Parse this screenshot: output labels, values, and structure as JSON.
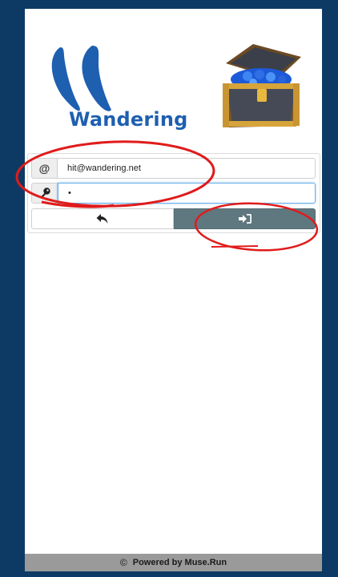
{
  "brand": {
    "name": "Wandering"
  },
  "login_form": {
    "email_addon": "@",
    "email_value": "hit@wandering.net",
    "password_value": "•",
    "back_icon": "reply-icon",
    "login_icon": "sign-in-icon"
  },
  "footer": {
    "copyright_symbol": "©",
    "text": "Powered by Muse.Run"
  },
  "colors": {
    "background": "#0d3a64",
    "brand_blue": "#1e5fb0",
    "login_button": "#5f7880",
    "footer": "#9a9a9a",
    "annotation_red": "#e01b1b"
  }
}
